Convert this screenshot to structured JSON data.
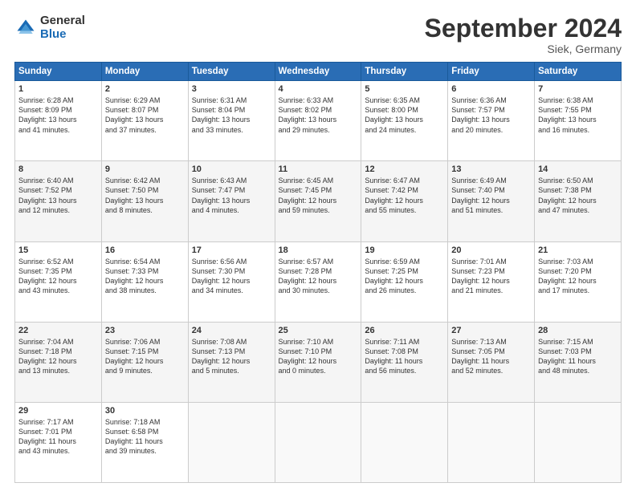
{
  "header": {
    "logo_general": "General",
    "logo_blue": "Blue",
    "title": "September 2024",
    "subtitle": "Siek, Germany"
  },
  "days_of_week": [
    "Sunday",
    "Monday",
    "Tuesday",
    "Wednesday",
    "Thursday",
    "Friday",
    "Saturday"
  ],
  "weeks": [
    [
      {
        "day": "1",
        "lines": [
          "Sunrise: 6:28 AM",
          "Sunset: 8:09 PM",
          "Daylight: 13 hours",
          "and 41 minutes."
        ]
      },
      {
        "day": "2",
        "lines": [
          "Sunrise: 6:29 AM",
          "Sunset: 8:07 PM",
          "Daylight: 13 hours",
          "and 37 minutes."
        ]
      },
      {
        "day": "3",
        "lines": [
          "Sunrise: 6:31 AM",
          "Sunset: 8:04 PM",
          "Daylight: 13 hours",
          "and 33 minutes."
        ]
      },
      {
        "day": "4",
        "lines": [
          "Sunrise: 6:33 AM",
          "Sunset: 8:02 PM",
          "Daylight: 13 hours",
          "and 29 minutes."
        ]
      },
      {
        "day": "5",
        "lines": [
          "Sunrise: 6:35 AM",
          "Sunset: 8:00 PM",
          "Daylight: 13 hours",
          "and 24 minutes."
        ]
      },
      {
        "day": "6",
        "lines": [
          "Sunrise: 6:36 AM",
          "Sunset: 7:57 PM",
          "Daylight: 13 hours",
          "and 20 minutes."
        ]
      },
      {
        "day": "7",
        "lines": [
          "Sunrise: 6:38 AM",
          "Sunset: 7:55 PM",
          "Daylight: 13 hours",
          "and 16 minutes."
        ]
      }
    ],
    [
      {
        "day": "8",
        "lines": [
          "Sunrise: 6:40 AM",
          "Sunset: 7:52 PM",
          "Daylight: 13 hours",
          "and 12 minutes."
        ]
      },
      {
        "day": "9",
        "lines": [
          "Sunrise: 6:42 AM",
          "Sunset: 7:50 PM",
          "Daylight: 13 hours",
          "and 8 minutes."
        ]
      },
      {
        "day": "10",
        "lines": [
          "Sunrise: 6:43 AM",
          "Sunset: 7:47 PM",
          "Daylight: 13 hours",
          "and 4 minutes."
        ]
      },
      {
        "day": "11",
        "lines": [
          "Sunrise: 6:45 AM",
          "Sunset: 7:45 PM",
          "Daylight: 12 hours",
          "and 59 minutes."
        ]
      },
      {
        "day": "12",
        "lines": [
          "Sunrise: 6:47 AM",
          "Sunset: 7:42 PM",
          "Daylight: 12 hours",
          "and 55 minutes."
        ]
      },
      {
        "day": "13",
        "lines": [
          "Sunrise: 6:49 AM",
          "Sunset: 7:40 PM",
          "Daylight: 12 hours",
          "and 51 minutes."
        ]
      },
      {
        "day": "14",
        "lines": [
          "Sunrise: 6:50 AM",
          "Sunset: 7:38 PM",
          "Daylight: 12 hours",
          "and 47 minutes."
        ]
      }
    ],
    [
      {
        "day": "15",
        "lines": [
          "Sunrise: 6:52 AM",
          "Sunset: 7:35 PM",
          "Daylight: 12 hours",
          "and 43 minutes."
        ]
      },
      {
        "day": "16",
        "lines": [
          "Sunrise: 6:54 AM",
          "Sunset: 7:33 PM",
          "Daylight: 12 hours",
          "and 38 minutes."
        ]
      },
      {
        "day": "17",
        "lines": [
          "Sunrise: 6:56 AM",
          "Sunset: 7:30 PM",
          "Daylight: 12 hours",
          "and 34 minutes."
        ]
      },
      {
        "day": "18",
        "lines": [
          "Sunrise: 6:57 AM",
          "Sunset: 7:28 PM",
          "Daylight: 12 hours",
          "and 30 minutes."
        ]
      },
      {
        "day": "19",
        "lines": [
          "Sunrise: 6:59 AM",
          "Sunset: 7:25 PM",
          "Daylight: 12 hours",
          "and 26 minutes."
        ]
      },
      {
        "day": "20",
        "lines": [
          "Sunrise: 7:01 AM",
          "Sunset: 7:23 PM",
          "Daylight: 12 hours",
          "and 21 minutes."
        ]
      },
      {
        "day": "21",
        "lines": [
          "Sunrise: 7:03 AM",
          "Sunset: 7:20 PM",
          "Daylight: 12 hours",
          "and 17 minutes."
        ]
      }
    ],
    [
      {
        "day": "22",
        "lines": [
          "Sunrise: 7:04 AM",
          "Sunset: 7:18 PM",
          "Daylight: 12 hours",
          "and 13 minutes."
        ]
      },
      {
        "day": "23",
        "lines": [
          "Sunrise: 7:06 AM",
          "Sunset: 7:15 PM",
          "Daylight: 12 hours",
          "and 9 minutes."
        ]
      },
      {
        "day": "24",
        "lines": [
          "Sunrise: 7:08 AM",
          "Sunset: 7:13 PM",
          "Daylight: 12 hours",
          "and 5 minutes."
        ]
      },
      {
        "day": "25",
        "lines": [
          "Sunrise: 7:10 AM",
          "Sunset: 7:10 PM",
          "Daylight: 12 hours",
          "and 0 minutes."
        ]
      },
      {
        "day": "26",
        "lines": [
          "Sunrise: 7:11 AM",
          "Sunset: 7:08 PM",
          "Daylight: 11 hours",
          "and 56 minutes."
        ]
      },
      {
        "day": "27",
        "lines": [
          "Sunrise: 7:13 AM",
          "Sunset: 7:05 PM",
          "Daylight: 11 hours",
          "and 52 minutes."
        ]
      },
      {
        "day": "28",
        "lines": [
          "Sunrise: 7:15 AM",
          "Sunset: 7:03 PM",
          "Daylight: 11 hours",
          "and 48 minutes."
        ]
      }
    ],
    [
      {
        "day": "29",
        "lines": [
          "Sunrise: 7:17 AM",
          "Sunset: 7:01 PM",
          "Daylight: 11 hours",
          "and 43 minutes."
        ]
      },
      {
        "day": "30",
        "lines": [
          "Sunrise: 7:18 AM",
          "Sunset: 6:58 PM",
          "Daylight: 11 hours",
          "and 39 minutes."
        ]
      },
      {
        "day": "",
        "lines": []
      },
      {
        "day": "",
        "lines": []
      },
      {
        "day": "",
        "lines": []
      },
      {
        "day": "",
        "lines": []
      },
      {
        "day": "",
        "lines": []
      }
    ]
  ]
}
